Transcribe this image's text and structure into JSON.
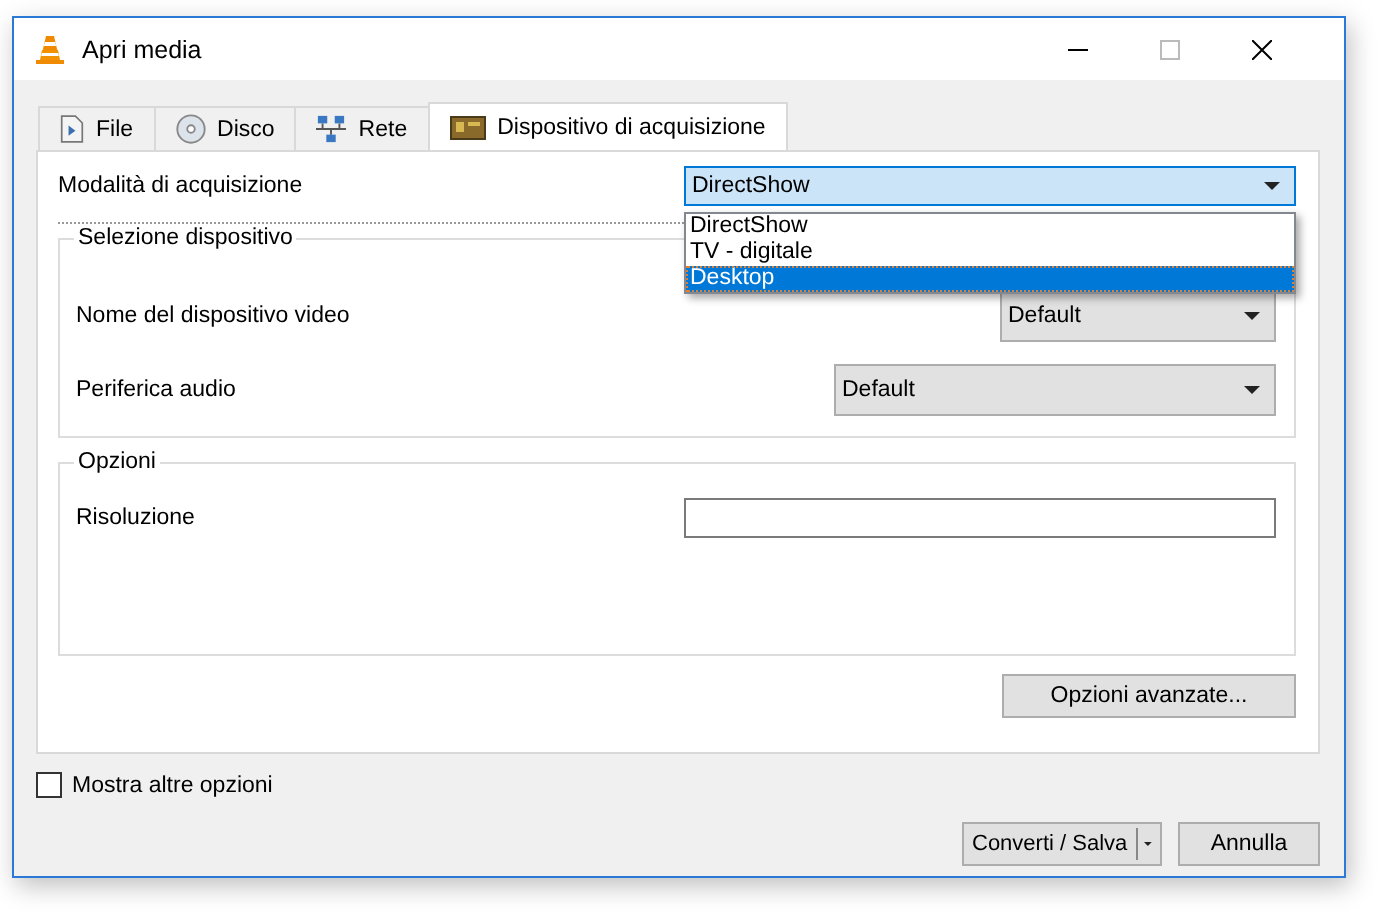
{
  "window": {
    "title": "Apri media"
  },
  "tabs": [
    {
      "label": "File",
      "selected": false
    },
    {
      "label": "Disco",
      "selected": false
    },
    {
      "label": "Rete",
      "selected": false
    },
    {
      "label": "Dispositivo di acquisizione",
      "selected": true
    }
  ],
  "capture_mode": {
    "label": "Modalità di acquisizione",
    "value": "DirectShow",
    "options": [
      {
        "label": "DirectShow",
        "highlighted": false
      },
      {
        "label": "TV - digitale",
        "highlighted": false
      },
      {
        "label": "Desktop",
        "highlighted": true
      }
    ]
  },
  "device_selection": {
    "title": "Selezione dispositivo",
    "video_device": {
      "label": "Nome del dispositivo video",
      "value": "Default"
    },
    "audio_device": {
      "label": "Periferica audio",
      "value": "Default"
    }
  },
  "options": {
    "title": "Opzioni",
    "resolution": {
      "label": "Risoluzione"
    },
    "advanced_button": "Opzioni avanzate..."
  },
  "show_more": {
    "label": "Mostra altre opzioni",
    "checked": false
  },
  "buttons": {
    "convert": "Converti / Salva",
    "cancel": "Annulla"
  }
}
